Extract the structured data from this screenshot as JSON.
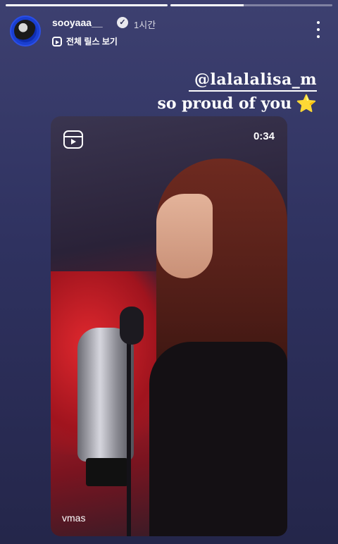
{
  "story": {
    "progress": [
      1.0,
      0.45
    ]
  },
  "header": {
    "username": "sooyaaa__",
    "verified_icon": "verified-check-icon",
    "time": "1시간",
    "reels_link": "전체 릴스 보기",
    "more_icon": "more-vertical-icon"
  },
  "overlay": {
    "mention": "@lalalalisa_m",
    "caption": "so proud of you",
    "emoji": "⭐"
  },
  "reel": {
    "icon": "reels-icon",
    "duration": "0:34",
    "label": "vmas"
  },
  "colors": {
    "background": "#2f3260",
    "accent_avatar": "#1a3fd0",
    "star": "#f5c12b"
  }
}
